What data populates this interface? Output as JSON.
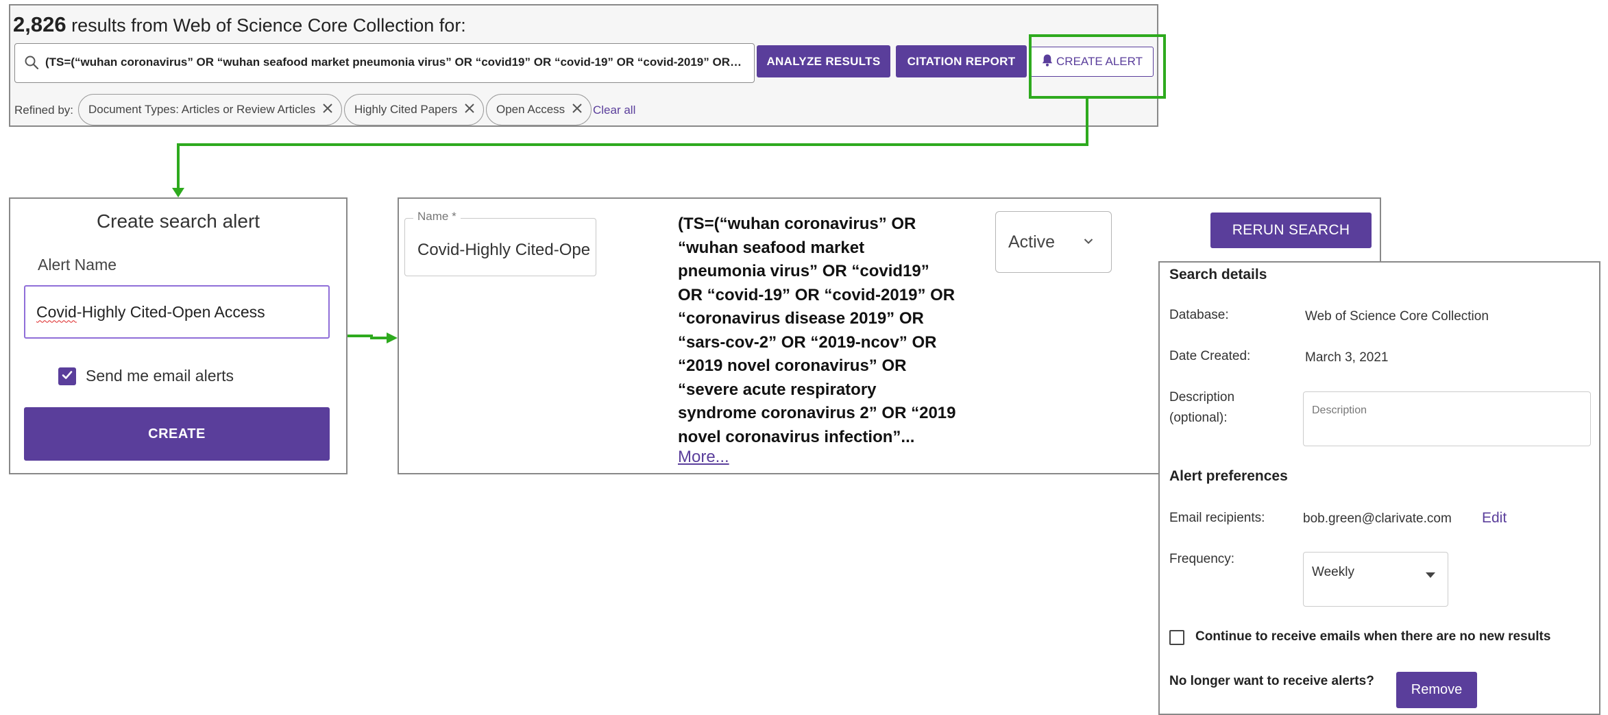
{
  "results": {
    "count": "2,826",
    "header_suffix": " results from Web of Science Core Collection for:",
    "query": "(TS=(“wuhan coronavirus” OR “wuhan seafood market pneumonia virus” OR “covid19” OR “covid-19” OR “covid-2019” OR …",
    "analyze_label": "ANALYZE RESULTS",
    "citation_label": "CITATION REPORT",
    "alert_label": "CREATE ALERT",
    "refined_by_label": "Refined by:",
    "chips": [
      "Document Types: Articles or Review Articles",
      "Highly Cited Papers",
      "Open Access"
    ],
    "clear_all_label": "Clear all"
  },
  "create_dialog": {
    "title": "Create search alert",
    "alert_name_label": "Alert Name",
    "alert_name_value_a": "Covid",
    "alert_name_value_b": "-Highly Cited-Open Access",
    "email_alerts_label": "Send me email alerts",
    "email_alerts_checked": true,
    "create_label": "CREATE"
  },
  "saved_search": {
    "name_label": "Name *",
    "name_value": "Covid-Highly Cited-Open Access",
    "query_lines": [
      "(TS=(“wuhan coronavirus” OR",
      "“wuhan seafood market",
      "pneumonia virus” OR “covid19”",
      "OR “covid-19” OR “covid-2019” OR",
      "“coronavirus disease 2019” OR",
      "“sars-cov-2” OR “2019-ncov” OR",
      "“2019 novel coronavirus” OR",
      "“severe acute respiratory",
      "syndrome coronavirus 2” OR “2019",
      "novel coronavirus infection”..."
    ],
    "more_label": "More...",
    "status_value": "Active",
    "rerun_label": "RERUN SEARCH"
  },
  "details": {
    "search_details_title": "Search details",
    "database_label": "Database:",
    "database_value": "Web of Science Core Collection",
    "date_label": "Date Created:",
    "date_value": "March 3, 2021",
    "description_label_1": "Description",
    "description_label_2": "(optional):",
    "description_placeholder": "Description",
    "prefs_title": "Alert preferences",
    "recipients_label": "Email recipients:",
    "recipients_value": "bob.green@clarivate.com",
    "edit_label": "Edit",
    "frequency_label": "Frequency:",
    "frequency_value": "Weekly",
    "continue_label": "Continue to receive emails when there are no new results",
    "continue_checked": false,
    "no_longer_label": "No longer want to receive alerts?",
    "remove_label": "Remove"
  },
  "colors": {
    "accent": "#5a3e9b",
    "highlight": "#2eaa1e",
    "focus_border": "#8f6ed8"
  }
}
